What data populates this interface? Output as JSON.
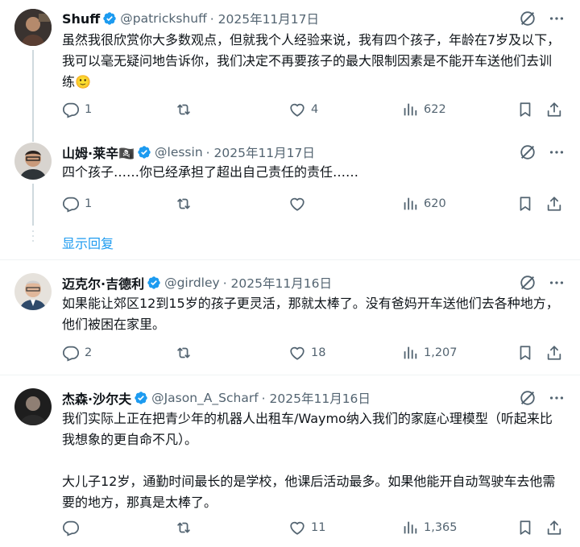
{
  "tweets": [
    {
      "name": "Shuff",
      "handle": "@patrickshuff",
      "date": "· 2025年11月17日",
      "text": "虽然我很欣赏你大多数观点，但就我个人经验来说，我有四个孩子，年龄在7岁及以下，我可以毫无疑问地告诉你，我们决定不再要孩子的最大限制因素是不能开车送他们去训练🙂",
      "replies": "1",
      "retweets": "",
      "likes": "4",
      "views": "622"
    },
    {
      "name": "山姆·莱辛🏴‍☠️",
      "handle": "@lessin",
      "date": "· 2025年11月17日",
      "text": "四个孩子……你已经承担了超出自己责任的责任……",
      "replies": "1",
      "retweets": "",
      "likes": "",
      "views": "620"
    },
    {
      "name": "迈克尔·吉德利",
      "handle": "@girdley",
      "date": "· 2025年11月16日",
      "text": "如果能让郊区12到15岁的孩子更灵活，那就太棒了。没有爸妈开车送他们去各种地方，他们被困在家里。",
      "replies": "2",
      "retweets": "",
      "likes": "18",
      "views": "1,207"
    },
    {
      "name": "杰森·沙尔夫",
      "handle": "@Jason_A_Scharf",
      "date": "· 2025年11月16日",
      "text": "我们实际上正在把青少年的机器人出租车/Waymo纳入我们的家庭心理模型（听起来比我想象的更自命不凡）。\n\n大儿子12岁，通勤时间最长的是学校，他课后活动最多。如果他能开自动驾驶车去他需要的地方，那真是太棒了。",
      "replies": "",
      "retweets": "",
      "likes": "11",
      "views": "1,365"
    }
  ],
  "show_replies": "显示回复",
  "colors": {
    "accent": "#1d9bf0",
    "muted": "#536471",
    "divider": "#eff3f4"
  }
}
